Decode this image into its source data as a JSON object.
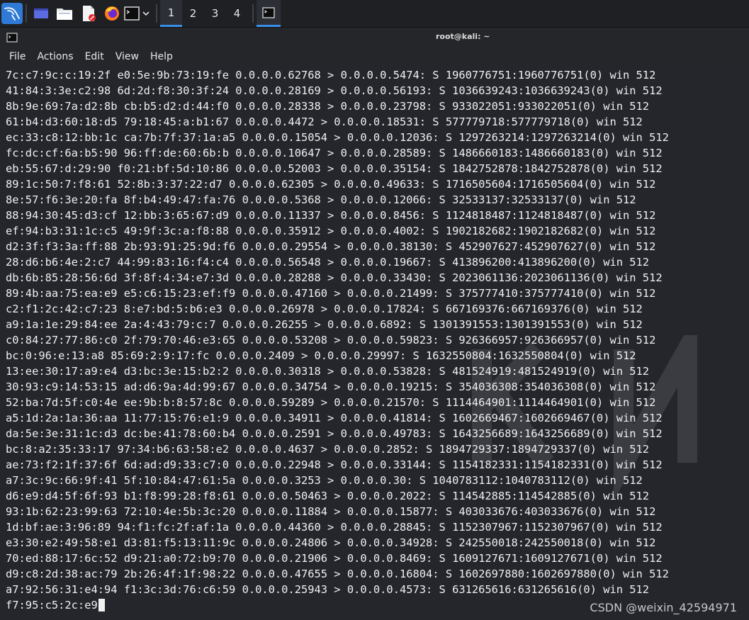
{
  "taskbar": {
    "workspaces": [
      "1",
      "2",
      "3",
      "4"
    ],
    "active_workspace": "1"
  },
  "window": {
    "title": "root@kali: ~"
  },
  "menu": {
    "items": [
      "File",
      "Actions",
      "Edit",
      "View",
      "Help"
    ]
  },
  "terminal": {
    "lines": [
      "7c:c7:9c:c:19:2f e0:5e:9b:73:19:fe 0.0.0.0.62768 > 0.0.0.0.5474: S 1960776751:1960776751(0) win 512",
      "41:84:3:3e:c2:98 6d:2d:f8:30:3f:24 0.0.0.0.28169 > 0.0.0.0.56193: S 1036639243:1036639243(0) win 512",
      "8b:9e:69:7a:d2:8b cb:b5:d2:d:44:f0 0.0.0.0.28338 > 0.0.0.0.23798: S 933022051:933022051(0) win 512",
      "61:b4:d3:60:18:d5 79:18:45:a:b1:67 0.0.0.0.4472 > 0.0.0.0.18531: S 577779718:577779718(0) win 512",
      "ec:33:c8:12:bb:1c ca:7b:7f:37:1a:a5 0.0.0.0.15054 > 0.0.0.0.12036: S 1297263214:1297263214(0) win 512",
      "fc:dc:cf:6a:b5:90 96:ff:de:60:6b:b 0.0.0.0.10647 > 0.0.0.0.28589: S 1486660183:1486660183(0) win 512",
      "eb:55:67:d:29:90 f0:21:bf:5d:10:86 0.0.0.0.52003 > 0.0.0.0.35154: S 1842752878:1842752878(0) win 512",
      "89:1c:50:7:f8:61 52:8b:3:37:22:d7 0.0.0.0.62305 > 0.0.0.0.49633: S 1716505604:1716505604(0) win 512",
      "8e:57:f6:3e:20:fa 8f:b4:49:47:fa:76 0.0.0.0.5368 > 0.0.0.0.12066: S 32533137:32533137(0) win 512",
      "88:94:30:45:d3:cf 12:bb:3:65:67:d9 0.0.0.0.11337 > 0.0.0.0.8456: S 1124818487:1124818487(0) win 512",
      "ef:94:b3:31:1c:c5 49:9f:3c:a:f8:88 0.0.0.0.35912 > 0.0.0.0.4002: S 1902182682:1902182682(0) win 512",
      "d2:3f:f3:3a:ff:88 2b:93:91:25:9d:f6 0.0.0.0.29554 > 0.0.0.0.38130: S 452907627:452907627(0) win 512",
      "28:d6:b6:4e:2:c7 44:99:83:16:f4:c4 0.0.0.0.56548 > 0.0.0.0.19667: S 413896200:413896200(0) win 512",
      "db:6b:85:28:56:6d 3f:8f:4:34:e7:3d 0.0.0.0.28288 > 0.0.0.0.33430: S 2023061136:2023061136(0) win 512",
      "89:4b:aa:75:ea:e9 e5:c6:15:23:ef:f9 0.0.0.0.47160 > 0.0.0.0.21499: S 375777410:375777410(0) win 512",
      "c2:f1:2c:42:c7:23 8:e7:bd:5:b6:e3 0.0.0.0.26978 > 0.0.0.0.17824: S 667169376:667169376(0) win 512",
      "a9:1a:1e:29:84:ee 2a:4:43:79:c:7 0.0.0.0.26255 > 0.0.0.0.6892: S 1301391553:1301391553(0) win 512",
      "c0:84:27:77:86:c0 2f:79:70:46:e3:65 0.0.0.0.53208 > 0.0.0.0.59823: S 926366957:926366957(0) win 512",
      "bc:0:96:e:13:a8 85:69:2:9:17:fc 0.0.0.0.2409 > 0.0.0.0.29997: S 1632550804:1632550804(0) win 512",
      "13:ee:30:17:a9:e4 d3:bc:3e:15:b2:2 0.0.0.0.30318 > 0.0.0.0.53828: S 481524919:481524919(0) win 512",
      "30:93:c9:14:53:15 ad:d6:9a:4d:99:67 0.0.0.0.34754 > 0.0.0.0.19215: S 354036308:354036308(0) win 512",
      "52:ba:7d:5f:c0:4e ee:9b:b:8:57:8c 0.0.0.0.59289 > 0.0.0.0.21570: S 1114464901:1114464901(0) win 512",
      "a5:1d:2a:1a:36:aa 11:77:15:76:e1:9 0.0.0.0.34911 > 0.0.0.0.41814: S 1602669467:1602669467(0) win 512",
      "da:5e:3e:31:1c:d3 dc:be:41:78:60:b4 0.0.0.0.2591 > 0.0.0.0.49783: S 1643256689:1643256689(0) win 512",
      "bc:8:a2:35:33:17 97:34:b6:63:58:e2 0.0.0.0.4637 > 0.0.0.0.2852: S 1894729337:1894729337(0) win 512",
      "ae:73:f2:1f:37:6f 6d:ad:d9:33:c7:0 0.0.0.0.22948 > 0.0.0.0.33144: S 1154182331:1154182331(0) win 512",
      "a7:3c:9c:66:9f:41 5f:10:84:47:61:5a 0.0.0.0.3253 > 0.0.0.0.30: S 1040783112:1040783112(0) win 512",
      "d6:e9:d4:5f:6f:93 b1:f8:99:28:f8:61 0.0.0.0.50463 > 0.0.0.0.2022: S 114542885:114542885(0) win 512",
      "93:1b:62:23:99:63 72:10:4e:5b:3c:20 0.0.0.0.11884 > 0.0.0.0.15877: S 403033676:403033676(0) win 512",
      "1d:bf:ae:3:96:89 94:f1:fc:2f:af:1a 0.0.0.0.44360 > 0.0.0.0.28845: S 1152307967:1152307967(0) win 512",
      "e3:30:e2:49:58:e1 d3:81:f5:13:11:9c 0.0.0.0.24806 > 0.0.0.0.34928: S 242550018:242550018(0) win 512",
      "70:ed:88:17:6c:52 d9:21:a0:72:b9:70 0.0.0.0.21906 > 0.0.0.0.8469: S 1609127671:1609127671(0) win 512",
      "d9:c8:2d:38:ac:79 2b:26:4f:1f:98:22 0.0.0.0.47655 > 0.0.0.0.16804: S 1602697880:1602697880(0) win 512",
      "a7:92:56:31:e4:94 f1:3c:3d:76:c6:59 0.0.0.0.25943 > 0.0.0.0.4573: S 631265616:631265616(0) win 512"
    ],
    "current_input": "f7:95:c5:2c:e9"
  },
  "watermark": {
    "text": "CSDN @weixin_42594971"
  },
  "colors": {
    "taskbar_bg": "#1f2024",
    "accent": "#3b8ee6",
    "terminal_bg": "#24262c",
    "text": "#f0f0f0"
  },
  "icons": [
    "kali-menu-icon",
    "workspace-switcher-icon",
    "file-manager-icon",
    "text-editor-icon",
    "firefox-icon",
    "terminal-icon",
    "chevron-down-icon",
    "terminal-window-icon"
  ]
}
